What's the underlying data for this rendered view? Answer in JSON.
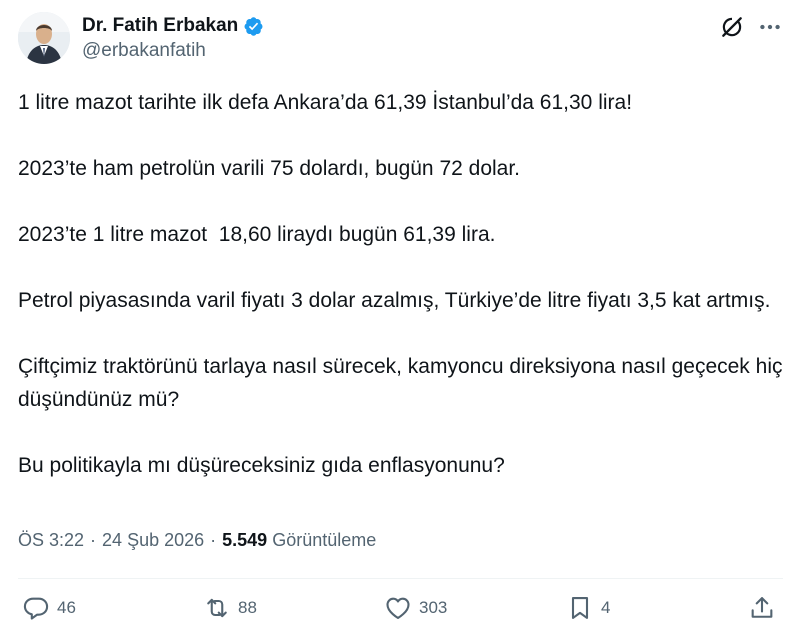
{
  "author": {
    "display_name": "Dr. Fatih Erbakan",
    "handle": "@erbakanfatih",
    "verified": true,
    "avatar_icon": "profile-photo"
  },
  "icons": {
    "grok": "grok-icon",
    "more": "more-icon"
  },
  "tweet": {
    "paragraphs": [
      "1 litre mazot tarihte ilk defa Ankara’da 61,39 İstanbul’da 61,30 lira!",
      "2023’te ham petrolün varili 75 dolardı, bugün 72 dolar.",
      "2023’te 1 litre mazot  18,60 liraydı bugün 61,39 lira.",
      "Petrol piyasasında varil fiyatı 3 dolar azalmış, Türkiye’de litre fiyatı 3,5 kat artmış.",
      "Çiftçimiz traktörünü tarlaya nasıl sürecek, kamyoncu direksiyona nasıl geçecek hiç düşündünüz mü?",
      "Bu politikayla mı düşüreceksiniz gıda enflasyonunu?"
    ]
  },
  "meta": {
    "time": "ÖS 3:22",
    "sep1": "·",
    "date": "24 Şub 2026",
    "sep2": "·",
    "views": "5.549",
    "views_label": "Görüntüleme"
  },
  "actions": {
    "replies": "46",
    "reposts": "88",
    "likes": "303",
    "bookmarks": "4"
  },
  "colors": {
    "text": "#0f1419",
    "secondary": "#536471",
    "verified": "#1d9bf0",
    "divider": "#eff3f4"
  }
}
